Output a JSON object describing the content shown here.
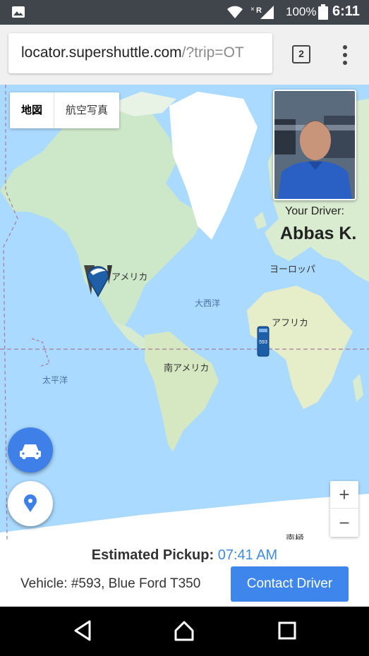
{
  "status_bar": {
    "battery_percent": "100%",
    "time": "6:11",
    "signal_letters": "R"
  },
  "browser": {
    "url_host": "locator.supershuttle.com",
    "url_path": "/?trip=OT",
    "tab_count": "2"
  },
  "map": {
    "type_toggle": {
      "map_label": "地図",
      "satellite_label": "航空写真"
    },
    "labels": {
      "america": "アメリカ",
      "europe": "ヨーロッパ",
      "atlantic": "大西洋",
      "africa": "アフリカ",
      "south_america": "南アメリカ",
      "pacific": "太平洋",
      "antarctica": "南極"
    },
    "vehicle_marker_number": "593",
    "zoom_in": "+",
    "zoom_out": "−"
  },
  "driver": {
    "caption": "Your Driver:",
    "name": "Abbas K."
  },
  "trip": {
    "eta_label": "Estimated Pickup:",
    "eta_time": "07:41 AM",
    "vehicle": "Vehicle: #593, Blue Ford T350",
    "contact_button": "Contact Driver"
  },
  "colors": {
    "accent": "#3f86ec",
    "water": "#aadaff",
    "land": "#cde8c8",
    "ice": "#ffffff"
  }
}
